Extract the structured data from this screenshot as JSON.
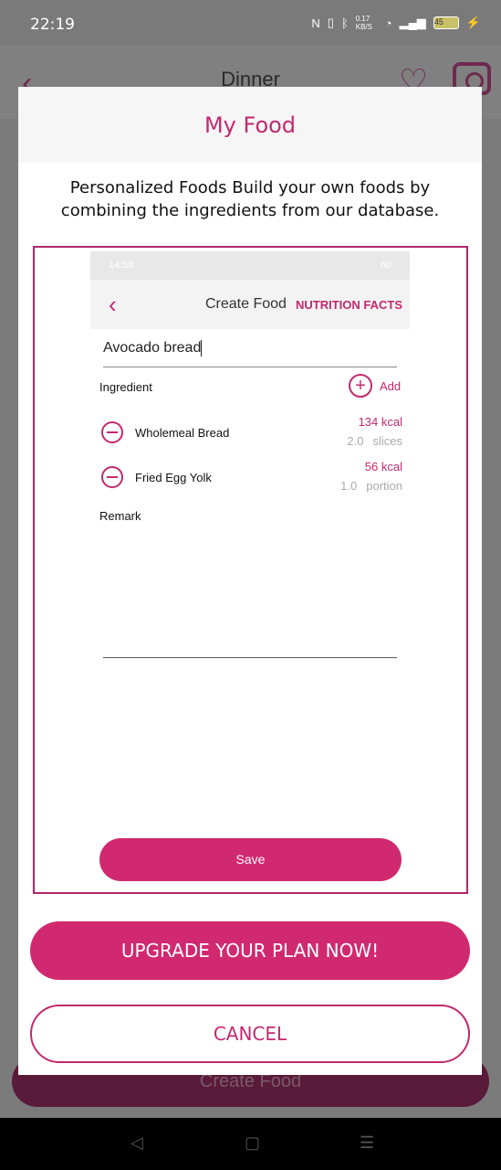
{
  "status_bar": {
    "time": "22:19",
    "net_speed": "0.17 KB/S",
    "battery": "45"
  },
  "background_screen": {
    "title": "Dinner",
    "create_button": "Create Food"
  },
  "dialog": {
    "title": "My Food",
    "description": "Personalized Foods Build your own foods by combining the ingredients from our database.",
    "preview": {
      "status_time": "14:58",
      "status_battery": "60",
      "toolbar_title": "Create Food",
      "nutrition_facts": "NUTRITION FACTS",
      "food_name": "Avocado bread",
      "ingredient_label": "Ingredient",
      "add_label": "Add",
      "ingredients": [
        {
          "name": "Wholemeal Bread",
          "kcal": "134 kcal",
          "amount": "2.0",
          "unit": "slices"
        },
        {
          "name": "Fried Egg Yolk",
          "kcal": "56 kcal",
          "amount": "1.0",
          "unit": "portion"
        }
      ],
      "remark_label": "Remark",
      "save_label": "Save"
    },
    "upgrade_label": "UPGRADE YOUR PLAN NOW!",
    "cancel_label": "CANCEL"
  },
  "colors": {
    "accent": "#d1296f",
    "accent_text": "#c2296f"
  }
}
